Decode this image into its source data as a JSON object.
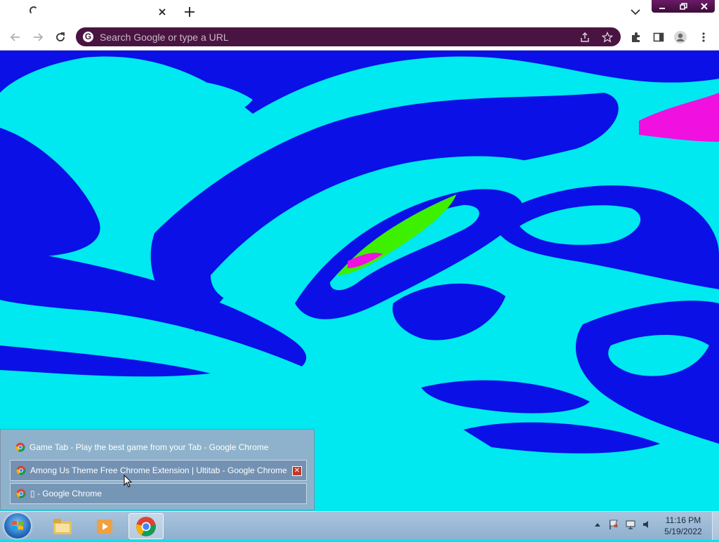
{
  "browser": {
    "tab": {
      "title": ""
    },
    "omnibox": {
      "placeholder": "Search Google or type a URL"
    }
  },
  "page": {
    "description_colors": {
      "background": "#00e8f0",
      "swirl": "#0a10e6",
      "accent_green": "#3cf000",
      "accent_magenta": "#f010e0"
    }
  },
  "taskbar_popup": {
    "items": [
      {
        "label": "Game Tab - Play the best game from your Tab - Google Chrome"
      },
      {
        "label": "Among Us Theme Free Chrome Extension | Ultitab - Google Chrome"
      },
      {
        "label": "▯ - Google Chrome"
      }
    ]
  },
  "taskbar": {
    "clock": {
      "time": "11:16 PM",
      "date": "5/19/2022"
    }
  }
}
